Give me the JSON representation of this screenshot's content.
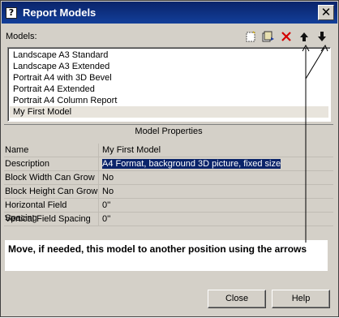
{
  "window": {
    "title": "Report Models",
    "title_icon": "?"
  },
  "models": {
    "label": "Models:",
    "items": [
      "Landscape A3 Standard",
      "Landscape A3 Extended",
      "Portrait A4 with 3D Bevel",
      "Portrait A4 Extended",
      "Portrait A4 Column Report",
      "My First Model"
    ],
    "selected": "My First Model"
  },
  "toolbar": {
    "icons": [
      "new-model-icon",
      "copy-model-icon",
      "delete-icon",
      "move-up-icon",
      "move-down-icon"
    ]
  },
  "properties": {
    "header": "Model Properties",
    "rows": [
      {
        "name": "Name",
        "value": "My First Model"
      },
      {
        "name": "Description",
        "value": "A4 Format, background 3D picture, fixed size"
      },
      {
        "name": "Block Width Can Grow",
        "value": "No"
      },
      {
        "name": "Block Height Can Grow",
        "value": "No"
      },
      {
        "name": "Horizontal Field Spacing",
        "value": "0''"
      },
      {
        "name": "Vertical Field Spacing",
        "value": "0''"
      }
    ]
  },
  "callout": {
    "text": "Move, if needed, this model to another position using the arrows"
  },
  "buttons": {
    "close": "Close",
    "help": "Help"
  },
  "colors": {
    "titlebar": "#0a246a",
    "window": "#d4d0c8",
    "highlight": "#0a246a",
    "delete": "#d40000"
  }
}
